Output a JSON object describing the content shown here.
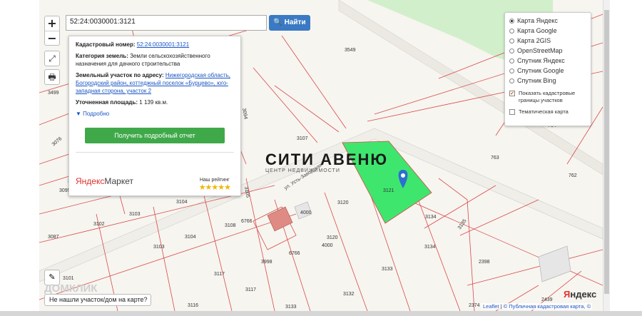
{
  "search": {
    "value": "52:24:0030001:3121",
    "button": "Найти"
  },
  "zoom": {
    "in": "+",
    "out": "−"
  },
  "popup": {
    "cadastral_label": "Кадастровый номер:",
    "cadastral_value": "52:24:0030001:3121",
    "category_label": "Категория земель:",
    "category_value": "Земли сельскохозяйственного назначения для дачного строительства",
    "address_label": "Земельный участок по адресу:",
    "address_value": "Нижегородская область, Богородский район, коттеджный поселок «Бурцево», юго-западная сторона, участок 2",
    "area_label": "Уточненная площадь:",
    "area_value": "1 139 кв.м.",
    "more": "Подробно",
    "report_button": "Получить подробный отчет",
    "market_ya": "Яндекс",
    "market_name": "Маркет",
    "rating_label": "Наш рейтинг",
    "stars": "★★★★★"
  },
  "layers": {
    "items": [
      {
        "label": "Карта Яндекс",
        "selected": true
      },
      {
        "label": "Карта Google",
        "selected": false
      },
      {
        "label": "Карта 2GIS",
        "selected": false
      },
      {
        "label": "OpenStreetMap",
        "selected": false
      },
      {
        "label": "Спутник Яндекс",
        "selected": false
      },
      {
        "label": "Спутник Google",
        "selected": false
      },
      {
        "label": "Спутник Bing",
        "selected": false
      }
    ],
    "check_cadastral": "Показать кадастровые границы участков",
    "check_thematic": "Тематическая карта"
  },
  "watermark": {
    "title": "СИТИ АВЕНЮ",
    "subtitle": "ЦЕНТР НЕДВИЖИМОСТИ"
  },
  "help": "Не нашли участок/дом на карте?",
  "domclick": "ДОМКЛИК",
  "attribution": {
    "leaflet": "Leaflet",
    "sep": "|",
    "source": "© Публичная кадастровая карта, ©"
  },
  "yandex_logo": {
    "ya": "Я",
    "rest": "ндекс"
  },
  "map": {
    "parcels": [
      "3549",
      "3499",
      "3076",
      "3094",
      "764",
      "763",
      "762",
      "3107",
      "3121",
      "3134",
      "3135",
      "3120",
      "4000",
      "3103",
      "3104",
      "3102",
      "3108",
      "3105",
      "3087",
      "3101",
      "3117",
      "3116",
      "6766",
      "3998",
      "3133",
      "3132",
      "2398",
      "2374",
      "2439",
      "3077",
      "3095"
    ],
    "street": "ул. Усть-Заводская"
  },
  "colors": {
    "highlight": "#3ee66e",
    "boundary": "#d84a4a",
    "park": "#c8ecc2",
    "accent": "#3a79c4",
    "button_green": "#3fa94a"
  }
}
